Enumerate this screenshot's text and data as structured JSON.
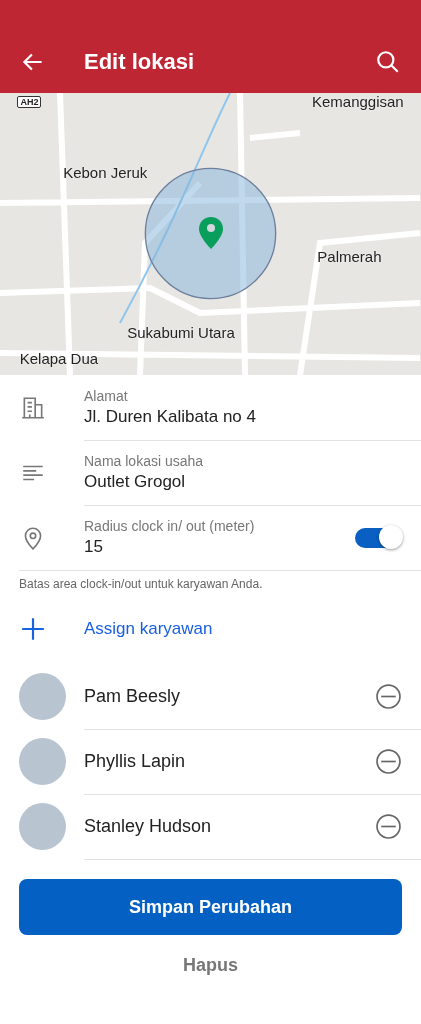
{
  "header": {
    "title": "Edit lokasi"
  },
  "map": {
    "labels": [
      {
        "text": "AH2",
        "kind": "shield"
      },
      {
        "text": "Kemanggisan",
        "kind": "place"
      },
      {
        "text": "Kebon Jeruk",
        "kind": "place"
      },
      {
        "text": "Palmerah",
        "kind": "place"
      },
      {
        "text": "Sukabumi Utara",
        "kind": "place"
      },
      {
        "text": "Kelapa Dua",
        "kind": "place"
      }
    ]
  },
  "fields": [
    {
      "kind": "building",
      "label": "Alamat",
      "value": "Jl. Duren Kalibata no 4"
    },
    {
      "kind": "lines",
      "label": "Nama lokasi usaha",
      "value": "Outlet Grogol"
    },
    {
      "kind": "pin",
      "label": "Radius clock in/ out (meter)",
      "value": "15",
      "toggle": {
        "on": true
      }
    }
  ],
  "hint": "Batas area clock-in/out untuk karyawan Anda.",
  "assign": {
    "label": "Assign karyawan"
  },
  "employees": [
    {
      "name": "Pam Beesly"
    },
    {
      "name": "Phyllis Lapin"
    },
    {
      "name": "Stanley Hudson"
    }
  ],
  "save_button": "Simpan Perubahan",
  "delete_button": "Hapus"
}
